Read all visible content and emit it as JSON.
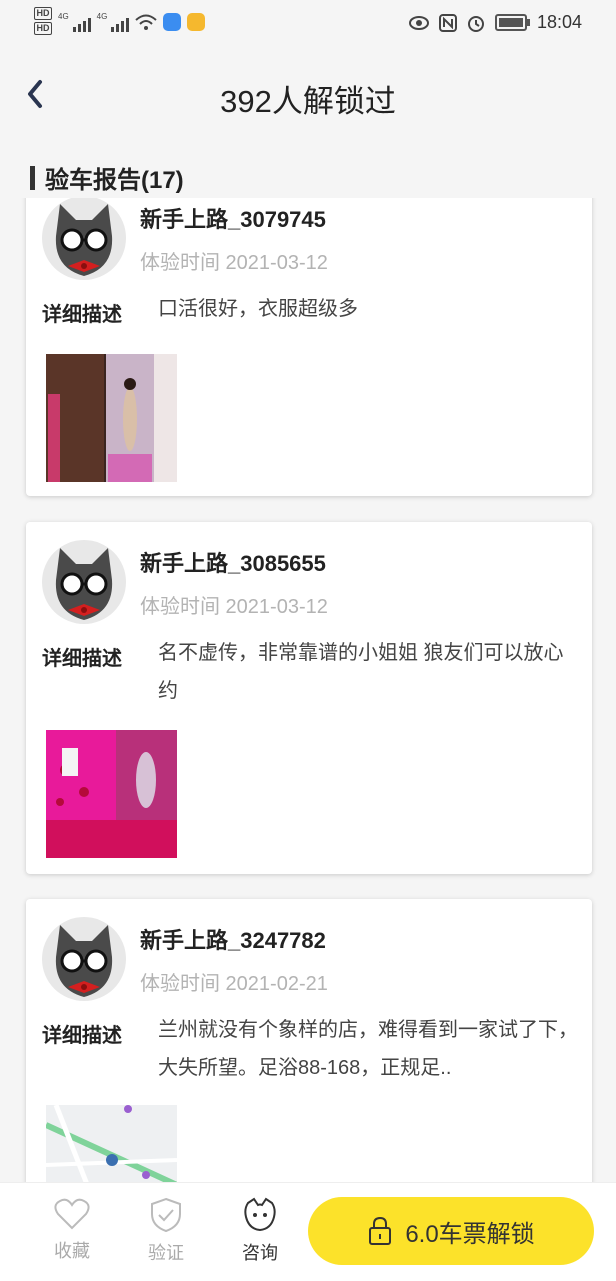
{
  "status_bar": {
    "hd1": "HD",
    "hd2": "HD",
    "net1": "4G",
    "net2": "4G",
    "time": "18:04"
  },
  "header": {
    "title": "392人解锁过"
  },
  "section": {
    "title": "验车报告(17)"
  },
  "reports": [
    {
      "username": "新手上路_3079745",
      "time": "体验时间 2021-03-12",
      "desc_label": "详细描述",
      "desc": "口活很好，衣服超级多"
    },
    {
      "username": "新手上路_3085655",
      "time": "体验时间 2021-03-12",
      "desc_label": "详细描述",
      "desc": "名不虚传，非常靠谱的小姐姐 狼友们可以放心约"
    },
    {
      "username": "新手上路_3247782",
      "time": "体验时间 2021-02-21",
      "desc_label": "详细描述",
      "desc": "兰州就没有个象样的店，难得看到一家试了下，大失所望。足浴88-168，正规足.."
    }
  ],
  "bottom": {
    "tabs": [
      {
        "label": "收藏",
        "icon": "heart-icon"
      },
      {
        "label": "验证",
        "icon": "shield-check-icon"
      },
      {
        "label": "咨询",
        "icon": "chat-face-icon"
      }
    ],
    "unlock_label": "6.0车票解锁"
  },
  "colors": {
    "accent": "#fce22a",
    "background": "#f5f5f5",
    "muted": "#b3b3b3"
  }
}
